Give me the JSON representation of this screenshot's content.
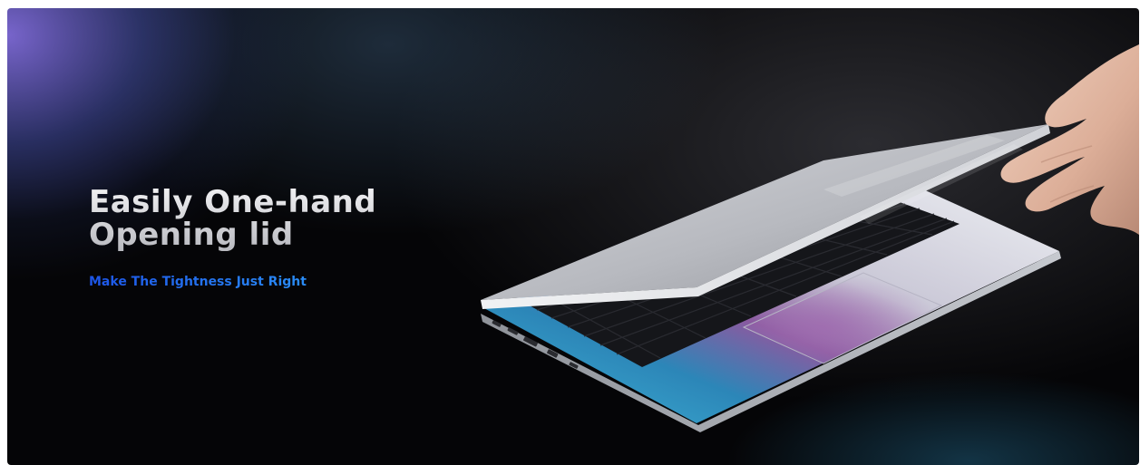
{
  "banner": {
    "headline_line1": "Easily One-hand",
    "headline_line2": "Opening lid",
    "subline": "Make The Tightness Just Right"
  },
  "colors": {
    "background": "#050507",
    "glow_purple": "#7e6ad6",
    "headline": "#d9d9de",
    "subline": "#1f6ff2",
    "laptop_silver": "#c9cbd0",
    "keyboard": "#15161a",
    "palmrest_cyan": "#3fb6d8"
  },
  "illustration": {
    "subject": "silver laptop with lid being opened by one hand",
    "icon": "laptop-illustration"
  }
}
